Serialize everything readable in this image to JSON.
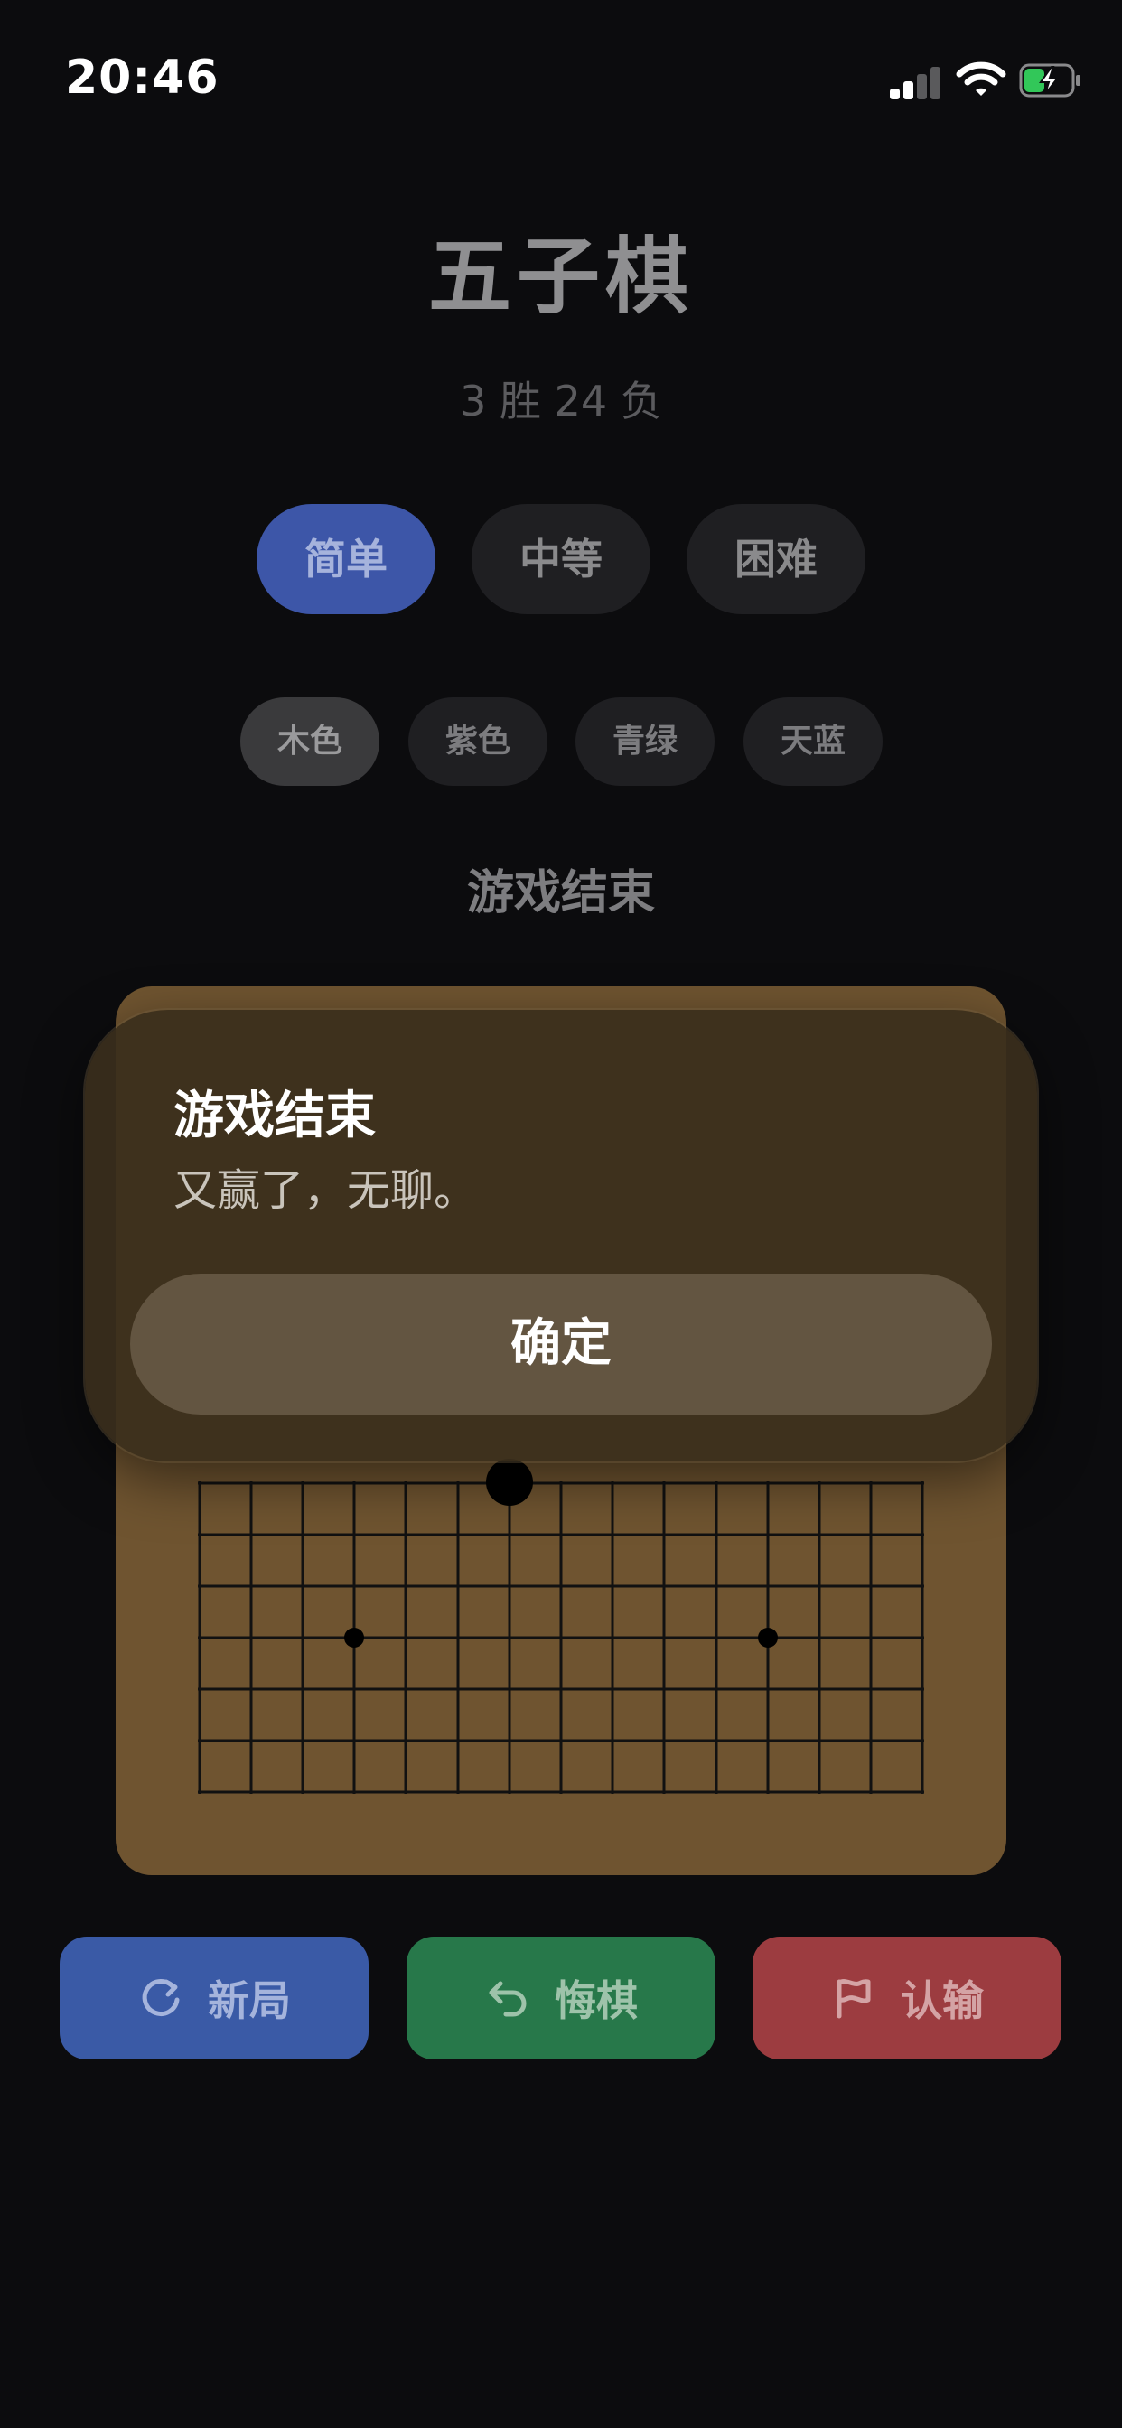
{
  "status_bar": {
    "time": "20:46"
  },
  "app": {
    "title": "五子棋",
    "record": "3 胜 24 负",
    "difficulty": {
      "options": [
        "简单",
        "中等",
        "困难"
      ],
      "selected": "简单"
    },
    "themes": {
      "options": [
        "木色",
        "紫色",
        "青绿",
        "天蓝"
      ],
      "selected": "木色"
    },
    "game_status": "游戏结束",
    "actions": {
      "new_game": "新局",
      "undo": "悔棋",
      "resign": "认输"
    }
  },
  "dialog": {
    "title": "游戏结束",
    "message": "又赢了，无聊。",
    "confirm": "确定"
  },
  "colors": {
    "background": "#0c0c0e",
    "accent_blue": "#3d56a8",
    "green": "#27784a",
    "red": "#9c3c40",
    "board_wood": "#6f5430"
  }
}
